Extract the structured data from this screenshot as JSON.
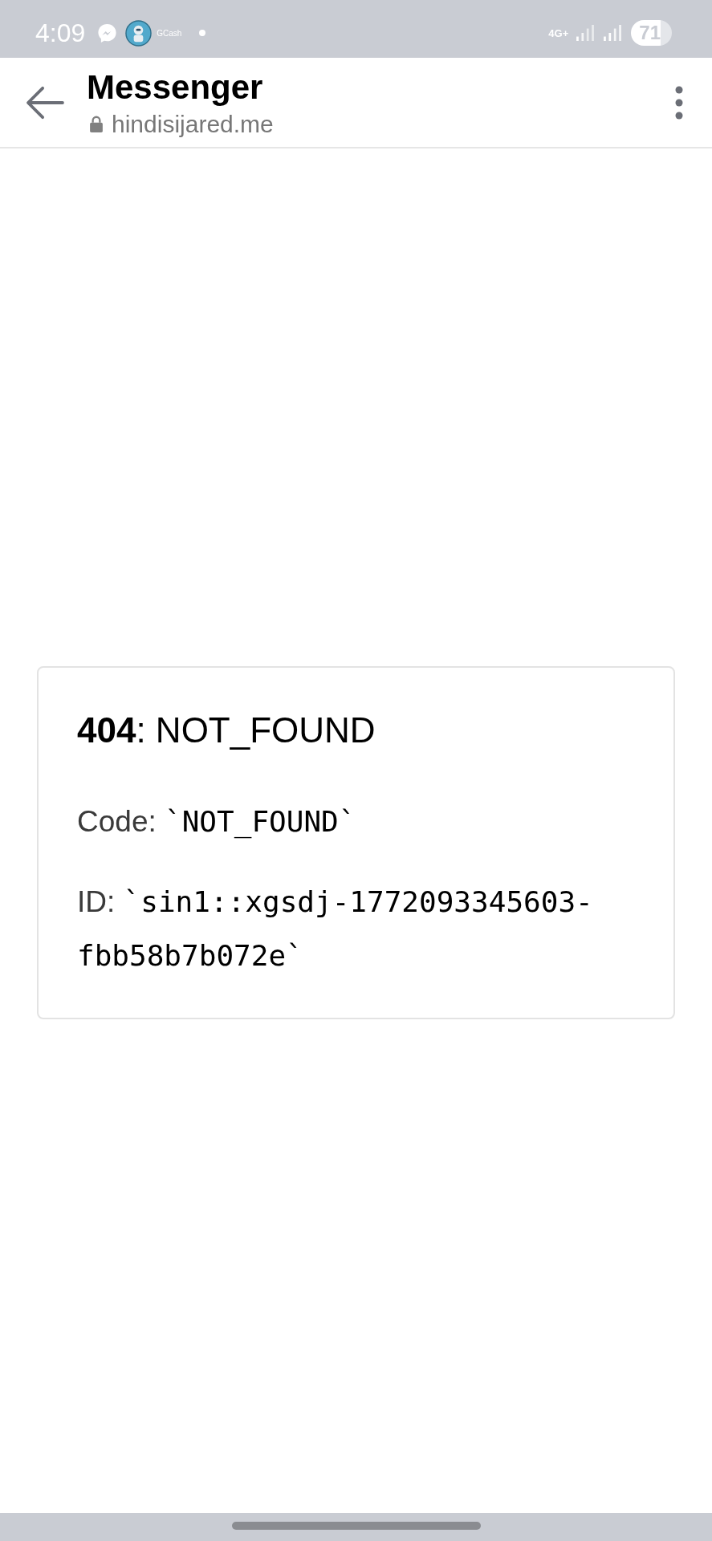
{
  "status_bar": {
    "time": "4:09",
    "notification_label": "GCash",
    "network_type": "4G+",
    "battery": "71"
  },
  "browser_bar": {
    "title": "Messenger",
    "url": "hindisijared.me"
  },
  "error_card": {
    "heading": "**404**: NOT_FOUND",
    "details": [
      {
        "label": "Code:",
        "value": "`NOT_FOUND`"
      },
      {
        "label": "ID:",
        "value": "`sin1::xgsdj-1772093345603-fbb58b7b072e`"
      }
    ]
  }
}
